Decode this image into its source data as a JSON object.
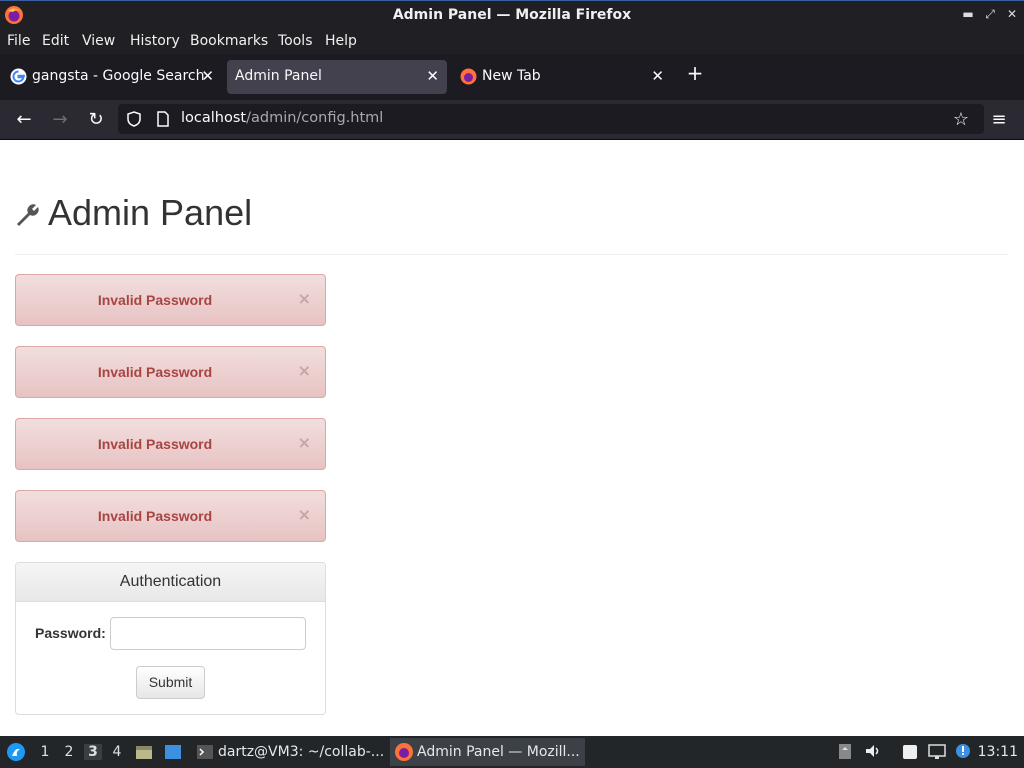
{
  "window": {
    "title": "Admin Panel — Mozilla Firefox"
  },
  "menu": [
    "File",
    "Edit",
    "View",
    "History",
    "Bookmarks",
    "Tools",
    "Help"
  ],
  "tabs": [
    {
      "label": "gangsta - Google Search",
      "icon": "google-icon"
    },
    {
      "label": "Admin Panel",
      "icon": "",
      "active": true
    },
    {
      "label": "New Tab",
      "icon": "firefox-icon"
    }
  ],
  "urlbar": {
    "host": "localhost",
    "path": "/admin/config.html"
  },
  "page": {
    "heading": "Admin Panel",
    "alerts": [
      "Invalid Password",
      "Invalid Password",
      "Invalid Password",
      "Invalid Password"
    ],
    "alert_close": "×",
    "panel_title": "Authentication",
    "password_label": "Password:",
    "password_value": "",
    "submit_label": "Submit"
  },
  "taskbar": {
    "workspaces": [
      "1",
      "2",
      "3",
      "4"
    ],
    "current_workspace": "3",
    "tasks": [
      {
        "label": "dartz@VM3: ~/collab-...",
        "icon": "terminal-icon"
      },
      {
        "label": "Admin Panel — Mozill...",
        "icon": "firefox-icon",
        "active": true
      }
    ],
    "clock": "13:11"
  },
  "colors": {
    "alert_bg": "#f2dede",
    "alert_text": "#a94442",
    "chrome_dark": "#1c1b22"
  }
}
